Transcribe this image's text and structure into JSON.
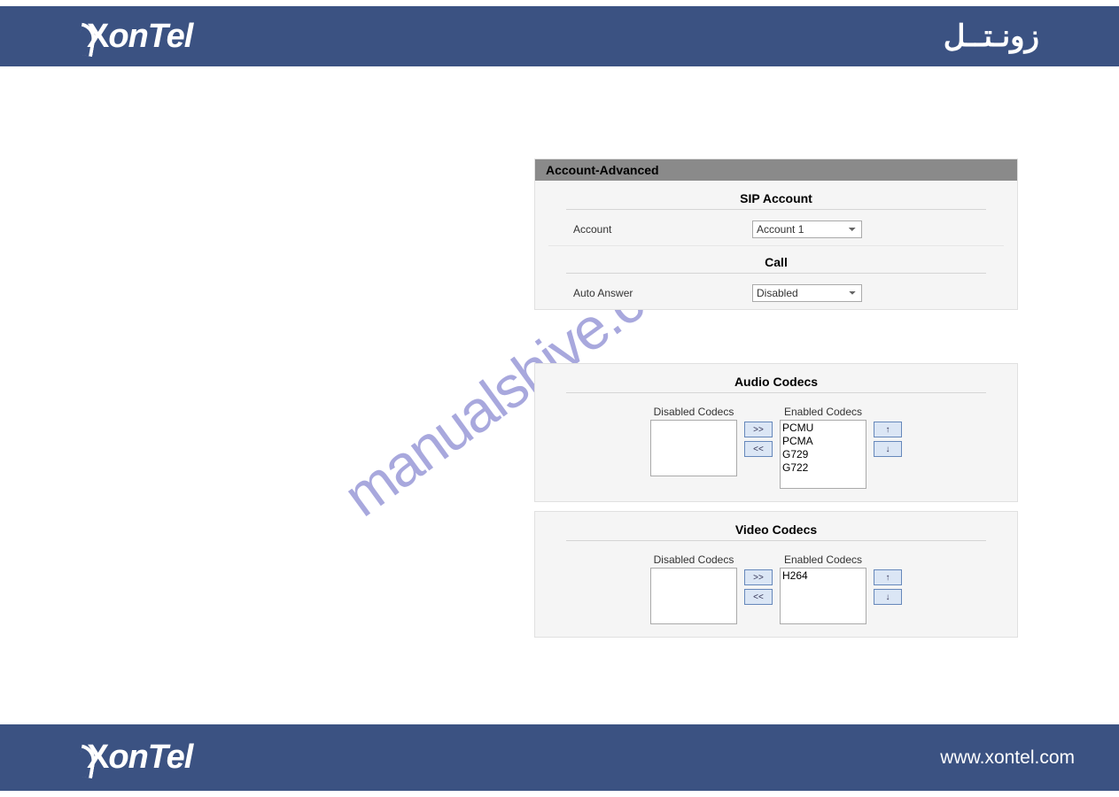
{
  "header": {
    "logo_text": "onTel",
    "logo_arabic": "زونـتــل"
  },
  "panel_title": "Account-Advanced",
  "sip_account": {
    "title": "SIP Account",
    "account_label": "Account",
    "account_value": "Account 1"
  },
  "call": {
    "title": "Call",
    "auto_answer_label": "Auto Answer",
    "auto_answer_value": "Disabled"
  },
  "audio_codecs": {
    "title": "Audio Codecs",
    "disabled_label": "Disabled Codecs",
    "enabled_label": "Enabled Codecs",
    "disabled_list": [],
    "enabled_list": [
      "PCMU",
      "PCMA",
      "G729",
      "G722"
    ],
    "btn_add": ">>",
    "btn_remove": "<<",
    "btn_up": "↑",
    "btn_down": "↓"
  },
  "video_codecs": {
    "title": "Video Codecs",
    "disabled_label": "Disabled Codecs",
    "enabled_label": "Enabled Codecs",
    "disabled_list": [],
    "enabled_list": [
      "H264"
    ],
    "btn_add": ">>",
    "btn_remove": "<<",
    "btn_up": "↑",
    "btn_down": "↓"
  },
  "footer": {
    "logo_text": "onTel",
    "url": "www.xontel.com"
  },
  "watermark": "manualshive.com"
}
